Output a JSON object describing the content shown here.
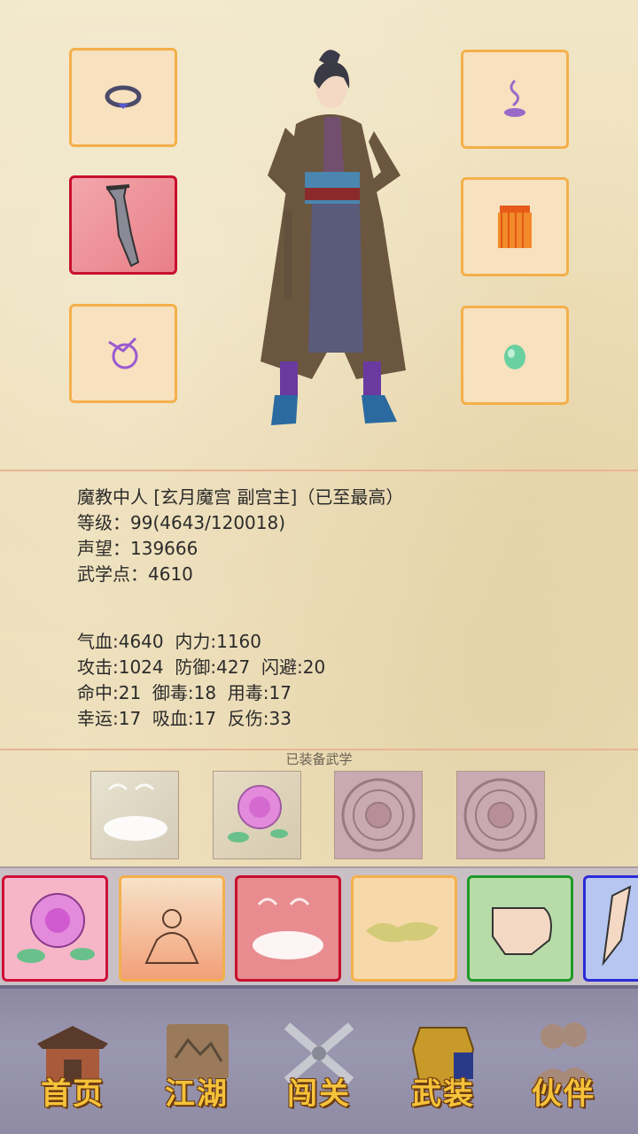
{
  "character": {
    "title_line": "魔教中人 [玄月魔宫 副宫主]（已至最高）",
    "level_line": "等级：99(4643/120018)",
    "prestige_line": "声望：139666",
    "martial_points_line": "武学点：4610"
  },
  "stats": {
    "line1": "气血:4640  内力:1160",
    "line2": "攻击:1024  防御:427  闪避:20",
    "line3": "命中:21  御毒:18  用毒:17",
    "line4": "幸运:17  吸血:17  反伤:33"
  },
  "equipment_slots": [
    {
      "name": "ring",
      "icon": "bracelet-icon",
      "selected": false
    },
    {
      "name": "weapon",
      "icon": "saber-icon",
      "selected": true
    },
    {
      "name": "charm",
      "icon": "ribbon-icon",
      "selected": false
    },
    {
      "name": "incense",
      "icon": "smoke-icon",
      "selected": false
    },
    {
      "name": "armor",
      "icon": "tassel-icon",
      "selected": false
    },
    {
      "name": "jade",
      "icon": "jade-icon",
      "selected": false
    }
  ],
  "martial_arts": {
    "title": "已装备武学",
    "equipped": [
      "mist-scroll",
      "rose-scroll",
      "empty-slot",
      "empty-slot"
    ]
  },
  "skills": [
    {
      "icon": "rose-icon",
      "border": "#d0103a"
    },
    {
      "icon": "meditation-icon",
      "border": "#f4b04b"
    },
    {
      "icon": "mist-icon",
      "border": "#c8102e"
    },
    {
      "icon": "moss-icon",
      "border": "#f4b04b"
    },
    {
      "icon": "fist-icon",
      "border": "#1f9a2a"
    },
    {
      "icon": "palm-icon",
      "border": "#2b2bd8"
    }
  ],
  "nav": {
    "home": "首页",
    "jianghu": "江湖",
    "challenge": "闯关",
    "equipment": "武装",
    "partner": "伙伴"
  }
}
